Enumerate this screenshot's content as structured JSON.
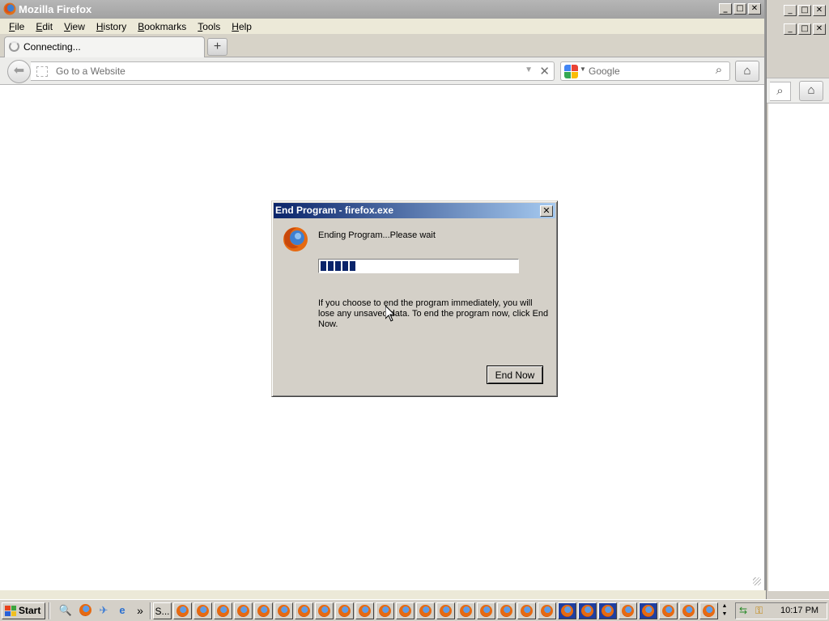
{
  "browser": {
    "window_title": "Mozilla Firefox",
    "menu": [
      "File",
      "Edit",
      "View",
      "History",
      "Bookmarks",
      "Tools",
      "Help"
    ],
    "menu_accel": [
      "F",
      "E",
      "V",
      "H",
      "B",
      "T",
      "H"
    ],
    "tab_label": "Connecting...",
    "new_tab_glyph": "+",
    "url_placeholder": "Go to a Website",
    "search_placeholder": "Google",
    "window_controls": [
      "minimize",
      "maximize",
      "close"
    ]
  },
  "dialog": {
    "title": "End Program - firefox.exe",
    "message": "Ending Program...Please wait",
    "progress_blocks": 5,
    "progress_fraction": 0.19,
    "info": "If you choose to end the program immediately, you will lose any unsaved data. To end the program now, click End Now.",
    "end_button": "End Now",
    "close_glyph": "✕"
  },
  "taskbar": {
    "start_label": "Start",
    "quick_launch": [
      "search-icon",
      "firefox-icon",
      "mail-icon",
      "ie-icon"
    ],
    "overflow_glyph": "»",
    "text_button": "S...",
    "firefox_buttons": 27,
    "active_buttons": [
      19,
      20,
      21,
      23
    ],
    "clock": "10:17 PM"
  },
  "colors": {
    "dialog_title_start": "#0a246a",
    "dialog_title_end": "#a6caf0",
    "progress_fill": "#0a246a",
    "inactive_title": "#a8a8a8"
  }
}
